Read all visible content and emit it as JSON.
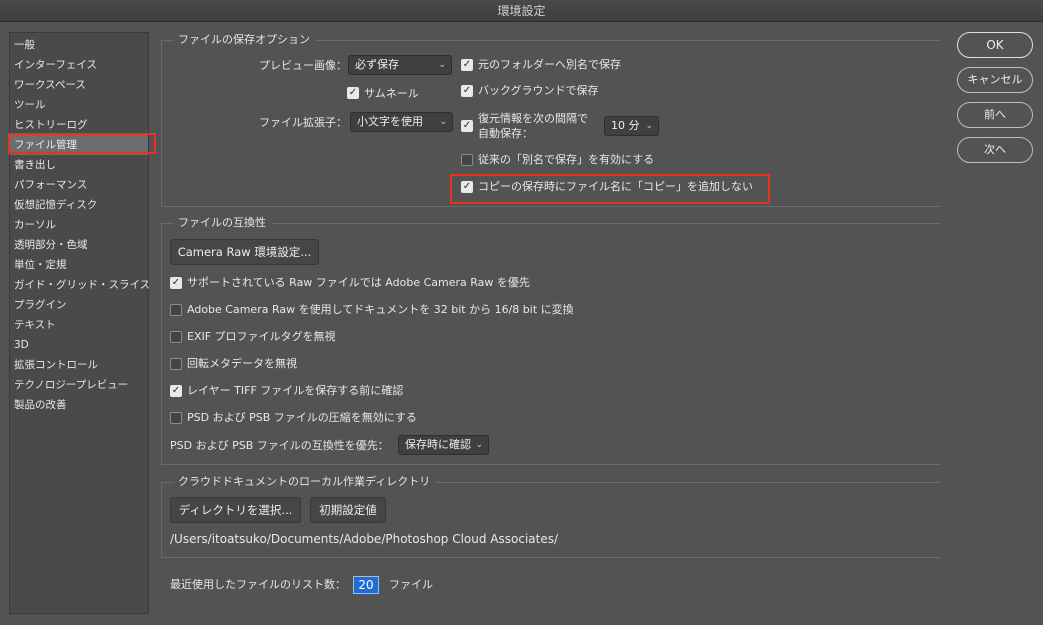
{
  "window": {
    "title": "環境設定"
  },
  "sidebar": {
    "items": [
      {
        "label": "一般"
      },
      {
        "label": "インターフェイス"
      },
      {
        "label": "ワークスペース"
      },
      {
        "label": "ツール"
      },
      {
        "label": "ヒストリーログ"
      },
      {
        "label": "ファイル管理",
        "selected": true
      },
      {
        "label": "書き出し"
      },
      {
        "label": "パフォーマンス"
      },
      {
        "label": "仮想記憶ディスク"
      },
      {
        "label": "カーソル"
      },
      {
        "label": "透明部分・色域"
      },
      {
        "label": "単位・定規"
      },
      {
        "label": "ガイド・グリッド・スライス"
      },
      {
        "label": "プラグイン"
      },
      {
        "label": "テキスト"
      },
      {
        "label": "3D"
      },
      {
        "label": "拡張コントロール"
      },
      {
        "label": "テクノロジープレビュー"
      },
      {
        "label": "製品の改善"
      }
    ]
  },
  "save_options": {
    "title": "ファイルの保存オプション",
    "preview_label": "プレビュー画像：",
    "preview_value": "必ず保存",
    "thumbnail": {
      "label": "サムネール",
      "checked": true
    },
    "extension_label": "ファイル拡張子：",
    "extension_value": "小文字を使用",
    "save_as_original_folder": {
      "label": "元のフォルダーへ別名で保存",
      "checked": true
    },
    "background_save": {
      "label": "バックグラウンドで保存",
      "checked": true
    },
    "auto_recovery": {
      "label_line1": "復元情報を次の間隔で",
      "label_line2": "自動保存：",
      "checked": true,
      "interval": "10 分"
    },
    "legacy_save_as": {
      "label": "従来の「別名で保存」を有効にする",
      "checked": false
    },
    "no_copy_suffix": {
      "label": "コピーの保存時にファイル名に「コピー」を追加しない",
      "checked": true
    }
  },
  "compatibility": {
    "title": "ファイルの互換性",
    "camera_raw_button": "Camera Raw 環境設定...",
    "options": [
      {
        "label": "サポートされている Raw ファイルでは Adobe Camera Raw を優先",
        "checked": true
      },
      {
        "label": "Adobe Camera Raw を使用してドキュメントを 32 bit から 16/8 bit に変換",
        "checked": false
      },
      {
        "label": "EXIF プロファイルタグを無視",
        "checked": false
      },
      {
        "label": "回転メタデータを無視",
        "checked": false
      },
      {
        "label": "レイヤー TIFF ファイルを保存する前に確認",
        "checked": true
      },
      {
        "label": "PSD および PSB ファイルの圧縮を無効にする",
        "checked": false
      }
    ],
    "psd_compat_label": "PSD および PSB ファイルの互換性を優先：",
    "psd_compat_value": "保存時に確認"
  },
  "cloud": {
    "title": "クラウドドキュメントのローカル作業ディレクトリ",
    "choose_button": "ディレクトリを選択...",
    "default_button": "初期設定値",
    "path": "/Users/itoatsuko/Documents/Adobe/Photoshop Cloud Associates/"
  },
  "recent": {
    "label": "最近使用したファイルのリスト数：",
    "value": "20",
    "unit": "ファイル"
  },
  "actions": {
    "ok": "OK",
    "cancel": "キャンセル",
    "prev": "前へ",
    "next": "次へ"
  },
  "icons": {
    "chevron": "chevron-up-down-icon",
    "check": "checkmark-icon"
  },
  "colors": {
    "background": "#535353",
    "highlight_border": "#e8321e",
    "input_highlight": "#1e6ed6"
  }
}
